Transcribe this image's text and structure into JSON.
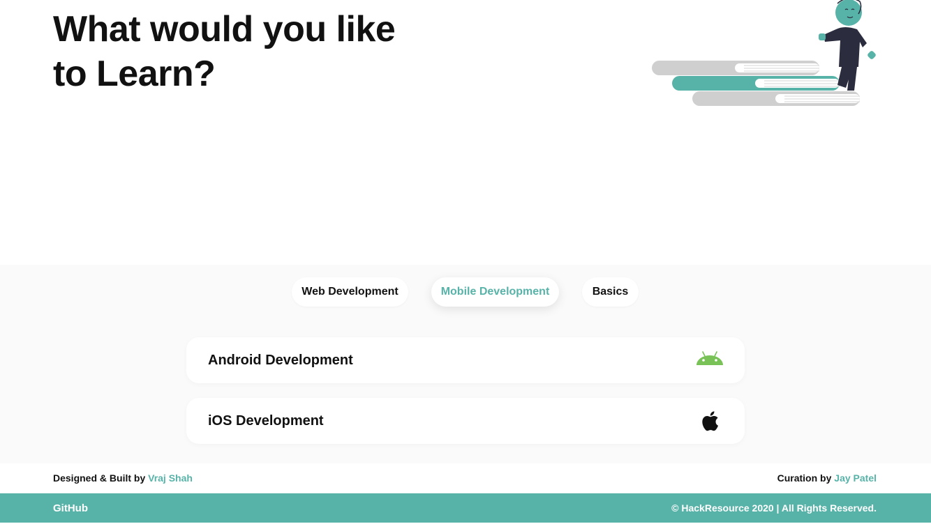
{
  "hero": {
    "title_line1": "What would you like",
    "title_line2": "to Learn?"
  },
  "tabs": [
    {
      "label": "Web Development",
      "active": false
    },
    {
      "label": "Mobile Development",
      "active": true
    },
    {
      "label": "Basics",
      "active": false
    }
  ],
  "cards": [
    {
      "label": "Android Development",
      "icon": "android-icon"
    },
    {
      "label": "iOS Development",
      "icon": "apple-icon"
    }
  ],
  "credits": {
    "designed_prefix": "Designed & Built by",
    "designer": "Vraj Shah",
    "curation_prefix": "Curation by",
    "curator": "Jay Patel"
  },
  "footer": {
    "github_label": "GitHub",
    "copyright": "© HackResource 2020 | All Rights Reserved."
  },
  "colors": {
    "accent": "#57b3a8",
    "android_green": "#78c257",
    "section_bg": "#fafafa",
    "text": "#111111"
  }
}
